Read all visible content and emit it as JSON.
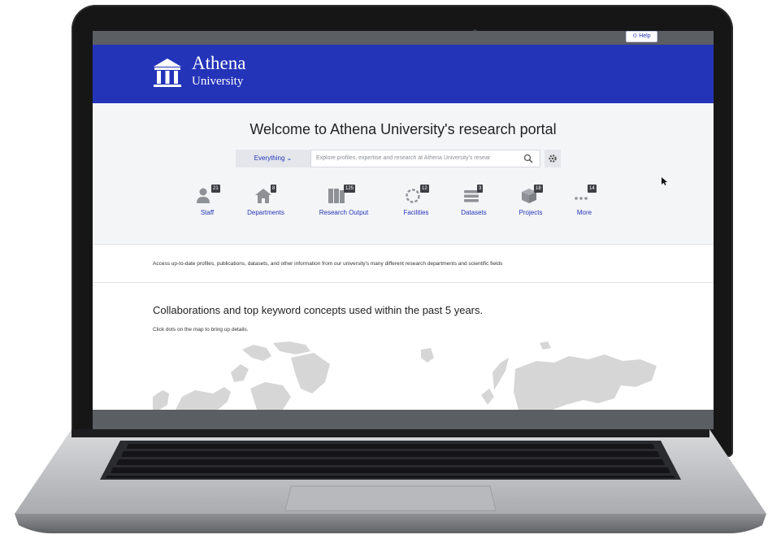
{
  "header": {
    "logo_name": "Athena",
    "logo_sub": "University",
    "help_label": "Help"
  },
  "hero": {
    "welcome": "Welcome to Athena University's research portal",
    "dropdown_value": "Everything",
    "search_placeholder": "Explore profiles, expertise and research at Athena University's resear"
  },
  "categories": [
    {
      "label": "Staff",
      "count": "21",
      "icon": "person-icon"
    },
    {
      "label": "Departments",
      "count": "8",
      "icon": "building-icon"
    },
    {
      "label": "Research Output",
      "count": "125",
      "icon": "book-icon"
    },
    {
      "label": "Facilities",
      "count": "12",
      "icon": "facility-icon"
    },
    {
      "label": "Datasets",
      "count": "3",
      "icon": "dataset-icon"
    },
    {
      "label": "Projects",
      "count": "18",
      "icon": "cube-icon"
    },
    {
      "label": "More",
      "count": "14",
      "icon": "ellipsis-icon"
    }
  ],
  "info": {
    "text": "Access up-to-date profiles, publications, datasets, and other information from our university's many different research departments and scientific fields"
  },
  "collab": {
    "title": "Collaborations and top keyword concepts used within the past 5 years.",
    "subtitle": "Click dots on the map to bring up details."
  },
  "colors": {
    "brand": "#2434b9",
    "badge": "#3c3f44",
    "icon_gray": "#8e9196",
    "map_gray": "#d6d6d6"
  }
}
